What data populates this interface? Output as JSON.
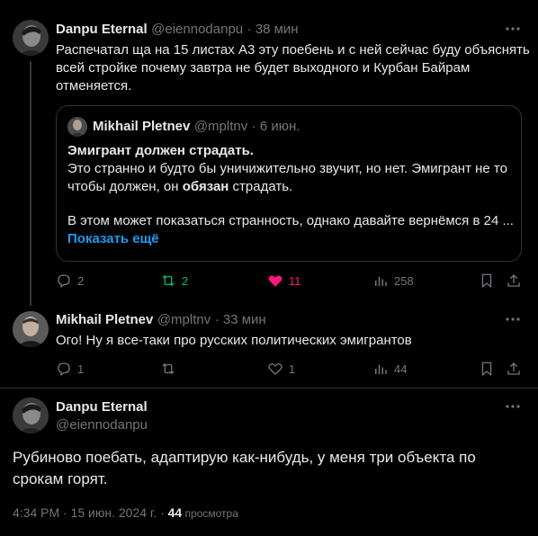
{
  "tweet1": {
    "author": "Danpu Eternal",
    "handle": "@eiennodanpu",
    "time": "· 38 мин",
    "text_l1": "Распечатал ща на 15 листах А3 эту поебень и с ней сейчас буду объяснять",
    "text_l2": "всей стройке почему завтра не будет выходного и Курбан Байрам",
    "text_l3": "отменяется.",
    "replies": "2",
    "reposts": "2",
    "likes": "11",
    "views": "258"
  },
  "quote": {
    "author": "Mikhail Pletnev",
    "handle": "@mpltnv",
    "time": "· 6 июн.",
    "heading": "Эмигрант должен страдать.",
    "l1": "Это странно и будто бы уничижительно звучит, но нет. Эмигрант не то",
    "l2_a": "чтобы должен, он ",
    "l2_b": "обязан",
    "l2_c": " страдать.",
    "l3": "В этом может показаться странность, однако давайте вернёмся в 24 ...",
    "show_more": "Показать ещё"
  },
  "tweet2": {
    "author": "Mikhail Pletnev",
    "handle": "@mpltnv",
    "time": "· 33 мин",
    "text": "Ого! Ну я все-таки про русских политических эмигрантов",
    "replies": "1",
    "reposts": "",
    "likes": "1",
    "views": "44"
  },
  "tweet3": {
    "author": "Danpu Eternal",
    "handle": "@eiennodanpu",
    "text_l1": "Рубиново поебать, адаптирую как-нибудь, у меня три объекта по",
    "text_l2": "срокам горят.",
    "meta_time": "4:34 PM · 15 июн. 2024 г. · ",
    "meta_views": "44",
    "meta_views_label": " просмотра"
  },
  "colors": {
    "background": "#000000",
    "text": "#e7e9ea",
    "muted": "#71767b",
    "like_active": "#f91880",
    "repost_active": "#00ba7c",
    "link": "#1d9bf0"
  },
  "icons": [
    "more-icon",
    "reply-icon",
    "repost-icon",
    "like-icon",
    "views-icon",
    "bookmark-icon",
    "share-icon"
  ]
}
